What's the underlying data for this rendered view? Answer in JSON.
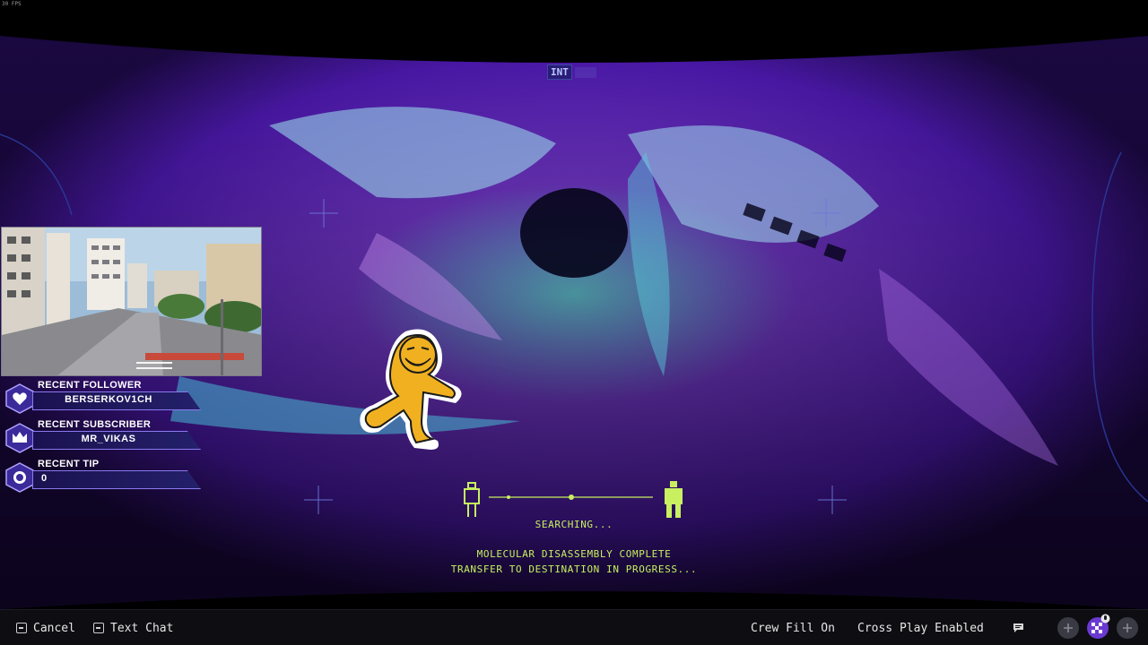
{
  "overlay": {
    "fps": "30 FPS",
    "int_label": "INT"
  },
  "alerts": [
    {
      "title": "RECENT FOLLOWER",
      "value": "BERSERKOV1CH",
      "icon": "heart-icon"
    },
    {
      "title": "RECENT SUBSCRIBER",
      "value": "MR_VIKAS",
      "icon": "crown-icon"
    },
    {
      "title": "RECENT TIP",
      "value": "0",
      "icon": "coin-icon"
    }
  ],
  "transfer": {
    "status": "SEARCHING...",
    "line1": "MOLECULAR DISASSEMBLY COMPLETE",
    "line2": "TRANSFER TO DESTINATION IN PROGRESS..."
  },
  "bottom_bar": {
    "cancel_label": "Cancel",
    "text_chat_label": "Text Chat",
    "crew_fill_label": "Crew Fill On",
    "cross_play_label": "Cross Play Enabled"
  },
  "colors": {
    "accent_green": "#c8f060",
    "alert_purple": "#8a7aee",
    "bar_bg": "#0d0d12"
  }
}
